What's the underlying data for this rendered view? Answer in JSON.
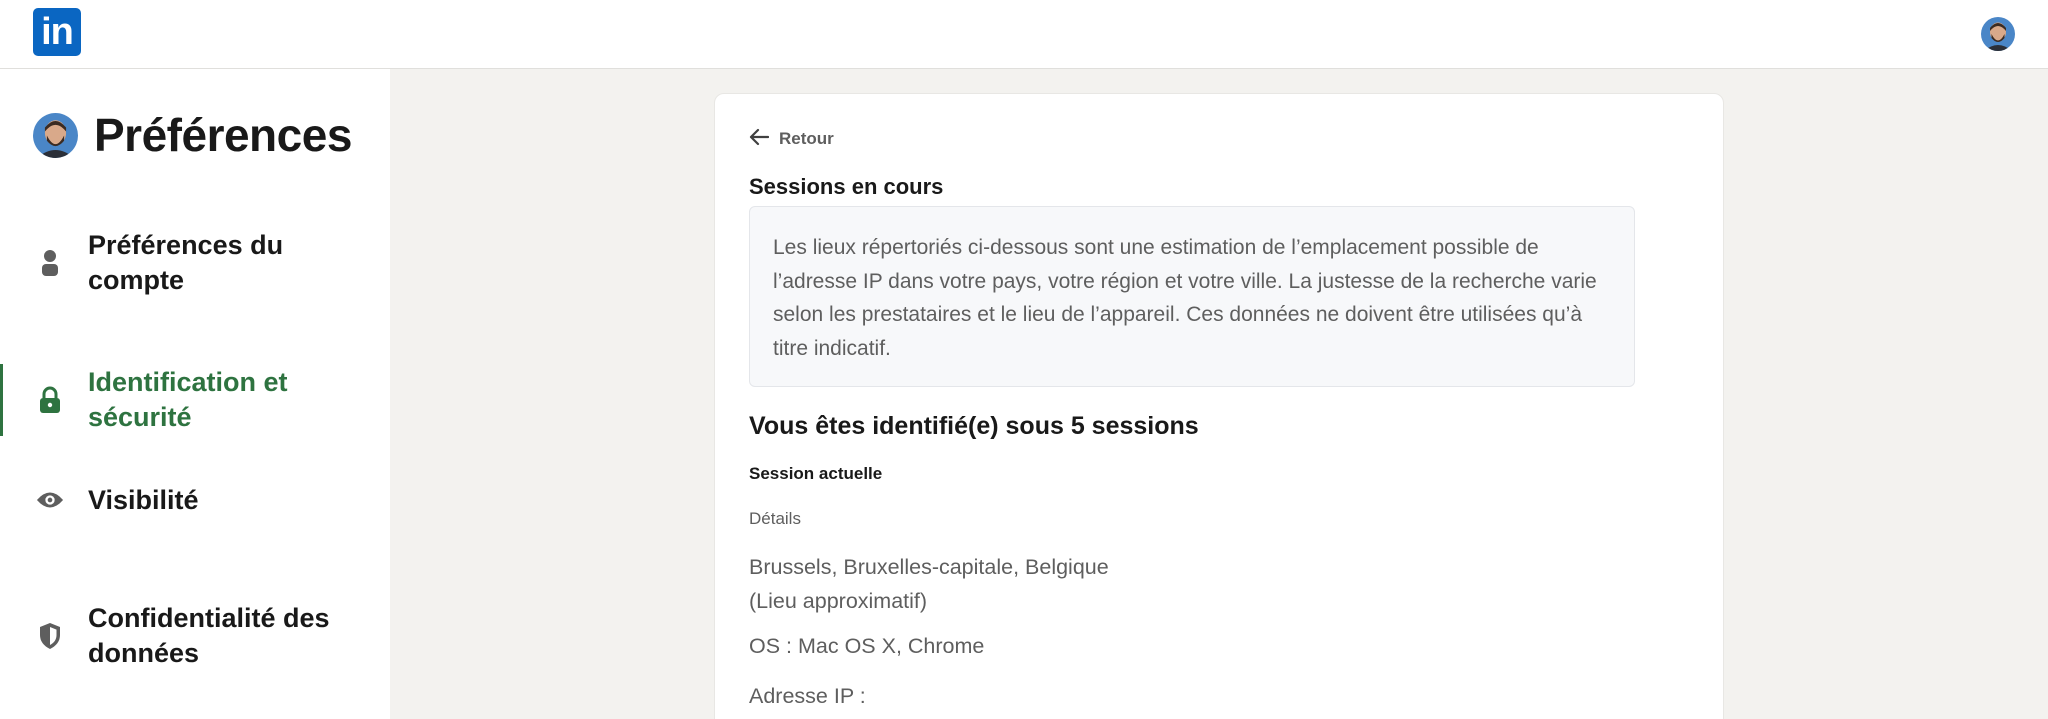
{
  "header": {
    "logo_text": "in",
    "avatar_icon": "profile-photo"
  },
  "sidebar": {
    "title": "Préférences",
    "items": [
      {
        "label": "Préférences du compte",
        "icon": "person-icon",
        "active": false
      },
      {
        "label": "Identification et sécurité",
        "icon": "lock-icon",
        "active": true
      },
      {
        "label": "Visibilité",
        "icon": "eye-icon",
        "active": false
      },
      {
        "label": "Confidentialité des données",
        "icon": "shield-icon",
        "active": false
      }
    ]
  },
  "main": {
    "back_label": "Retour",
    "section_title": "Sessions en cours",
    "info_text": "Les lieux répertoriés ci-dessous sont une estimation de l’emplacement possible de l’adresse IP dans votre pays, votre région et votre ville. La justesse de la recherche varie selon les prestataires et le lieu de l’appareil. Ces données ne doivent être utilisées qu’à titre indicatif.",
    "sessions_title": "Vous êtes identifié(e) sous 5 sessions",
    "current_session_label": "Session actuelle",
    "details_label": "Détails",
    "location_line1": "Brussels, Bruxelles-capitale, Belgique",
    "location_line2": "(Lieu approximatif)",
    "os_text": "OS : Mac OS X, Chrome",
    "ip_text": "Adresse IP :"
  },
  "colors": {
    "brand": "#0a66c2",
    "active": "#2e7340",
    "background": "#f3f2ef"
  }
}
